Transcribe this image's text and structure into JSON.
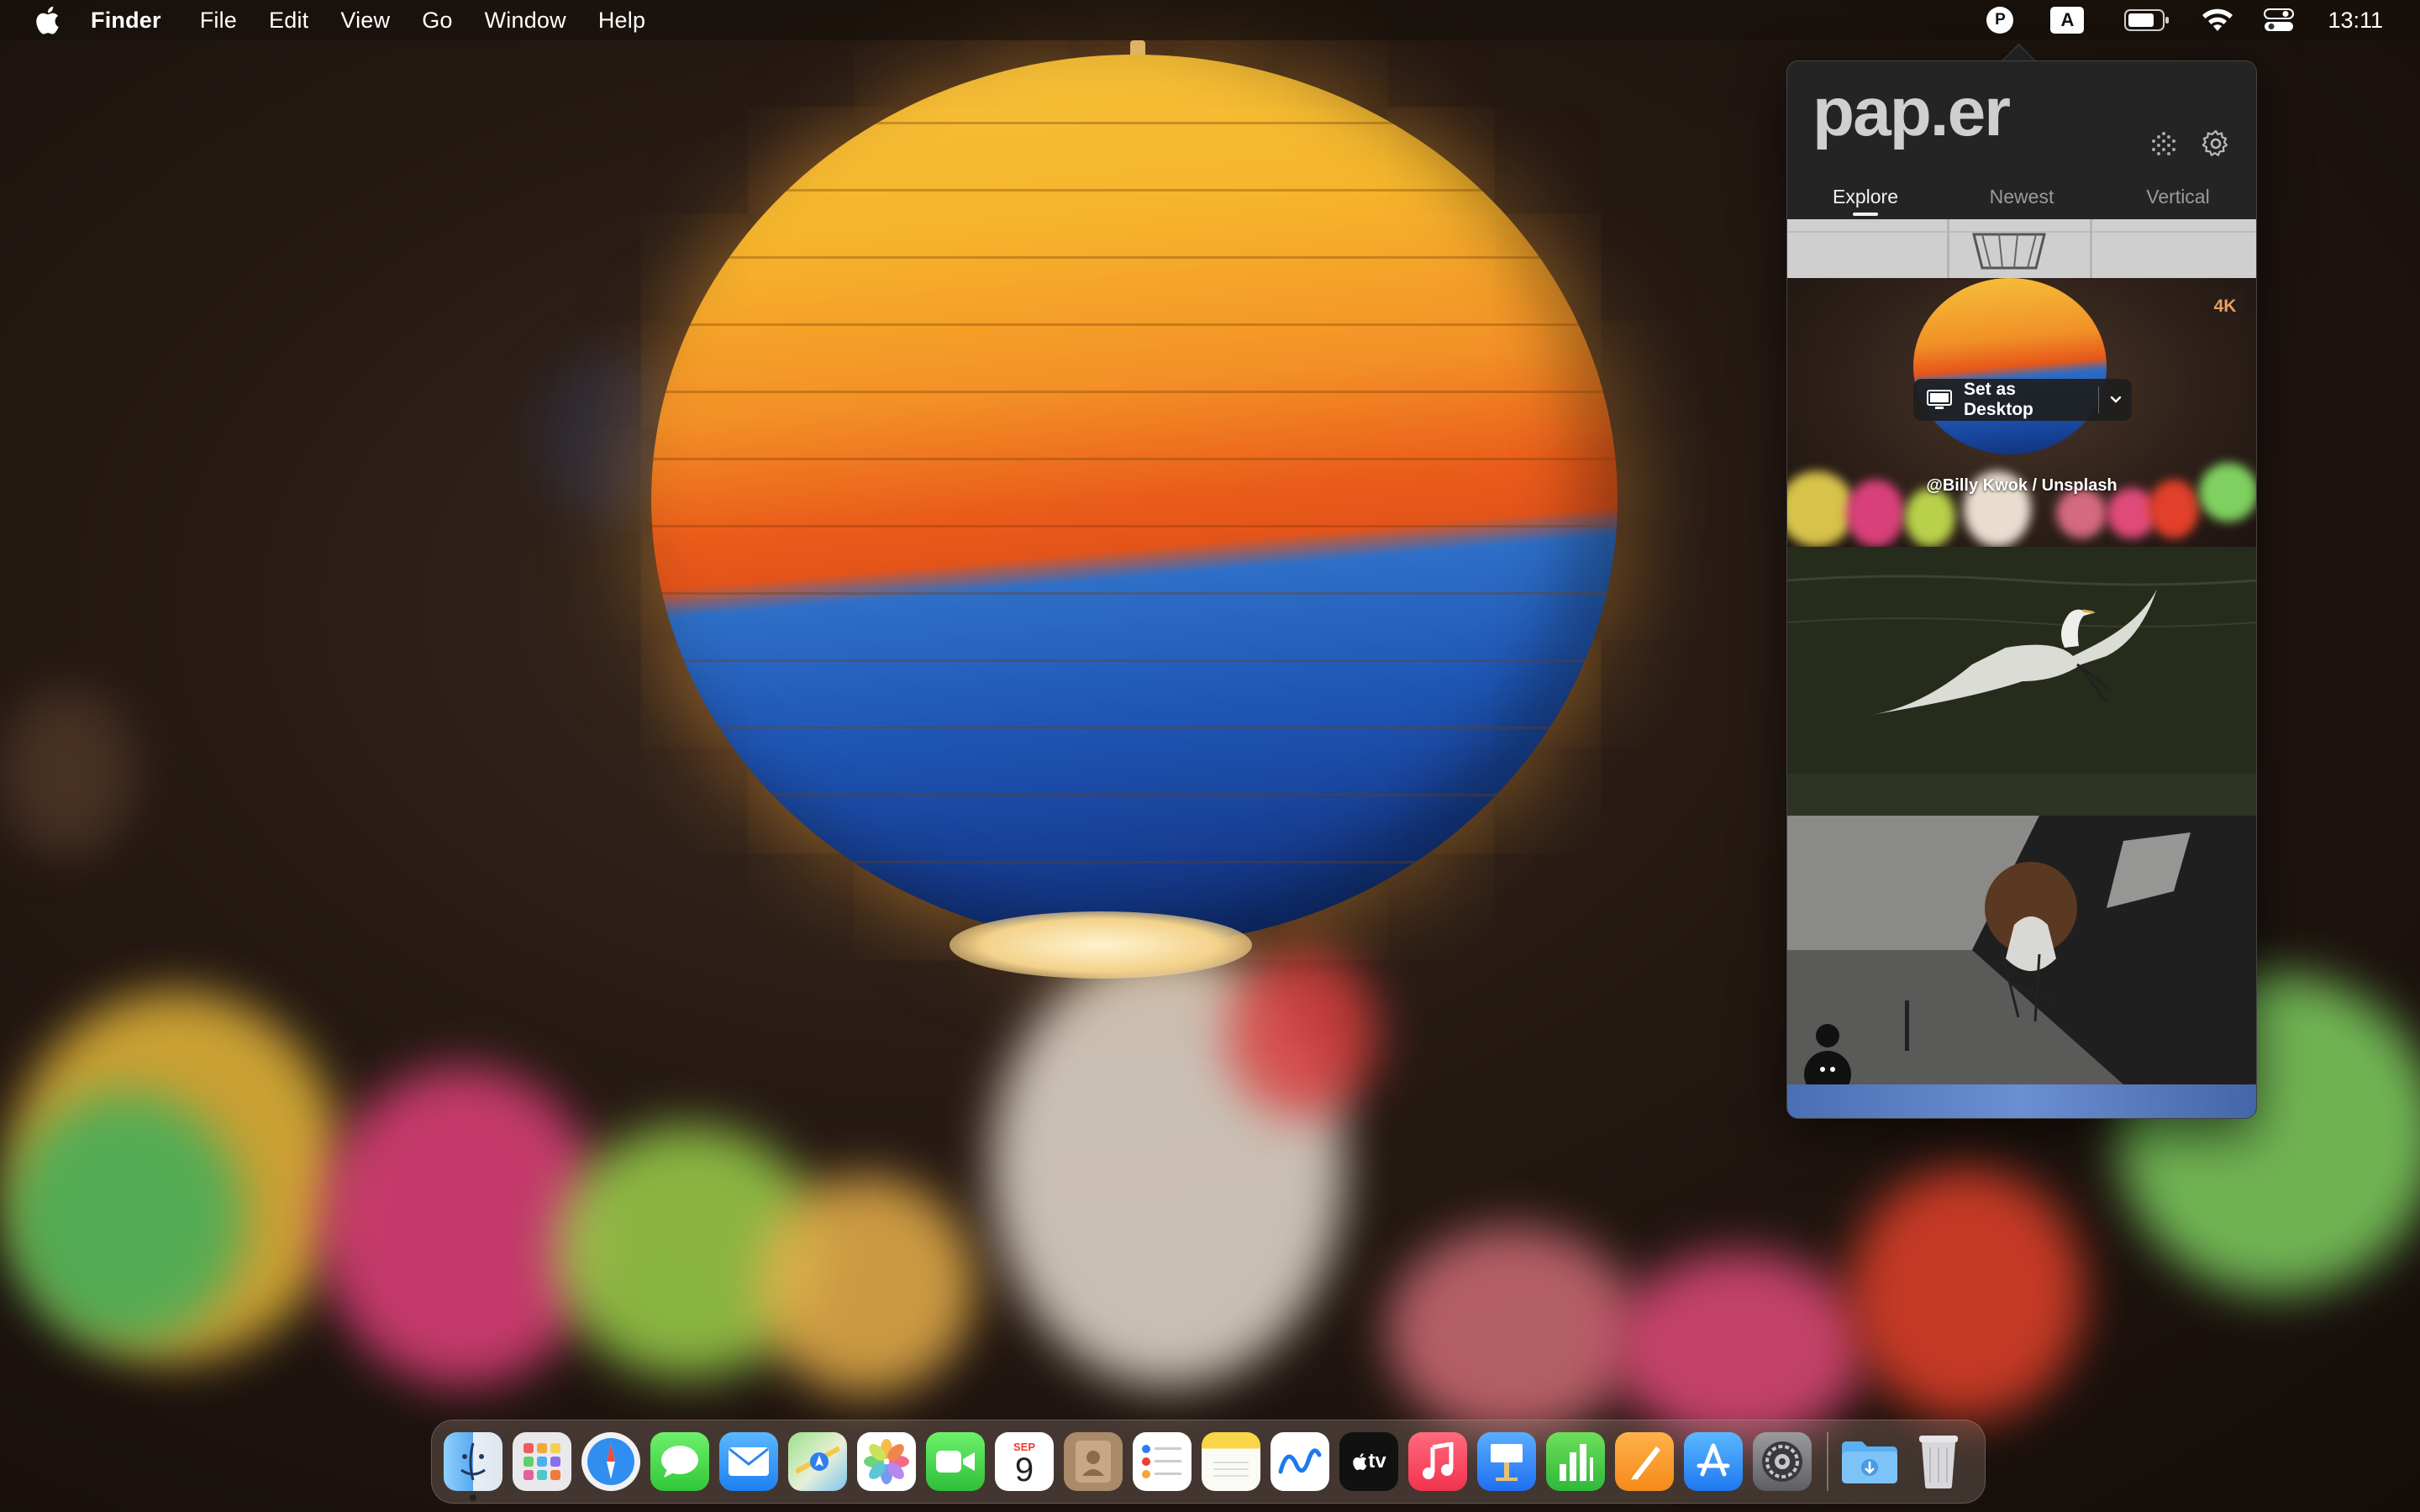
{
  "menubar": {
    "app_name": "Finder",
    "menus": [
      "File",
      "Edit",
      "View",
      "Go",
      "Window",
      "Help"
    ],
    "status_icons": [
      "paper-app-icon",
      "input-source-icon",
      "battery-icon",
      "wifi-icon",
      "control-center-icon"
    ],
    "input_source_letter": "A",
    "paper_letter": "P",
    "clock": "13:11"
  },
  "paper": {
    "logo": "pap.er",
    "tabs": [
      "Explore",
      "Newest",
      "Vertical"
    ],
    "active_tab": "Explore",
    "featured": {
      "badge": "4K",
      "set_desktop_label": "Set as Desktop",
      "credit": "@Billy Kwok / Unsplash"
    }
  },
  "dock": {
    "apps": [
      "Finder",
      "Launchpad",
      "Safari",
      "Messages",
      "Mail",
      "Maps",
      "Photos",
      "FaceTime",
      "Calendar",
      "Contacts",
      "Reminders",
      "Notes",
      "Freeform",
      "TV",
      "Music",
      "Keynote",
      "Numbers",
      "Pages",
      "App Store",
      "System Settings"
    ],
    "calendar_month": "SEP",
    "calendar_day": "9",
    "tv_label": "tv",
    "extras": [
      "Downloads",
      "Trash"
    ]
  }
}
